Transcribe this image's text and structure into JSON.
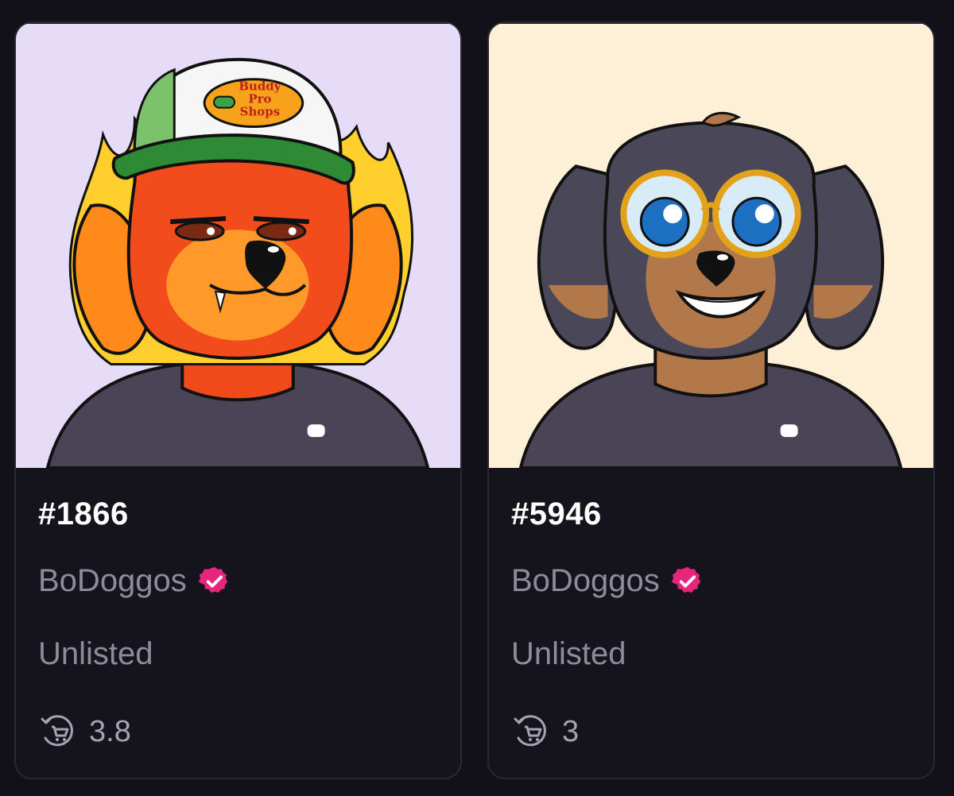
{
  "colors": {
    "page_background": "#121019",
    "card_background": "#15131c",
    "card_border": "#2b2835",
    "text_primary": "#ffffff",
    "text_secondary": "#8f8b9c",
    "verified_badge": "#e8257c"
  },
  "cards": [
    {
      "token_id": "#1866",
      "collection": "BoDoggos",
      "verified_icon": "verified-check-icon",
      "status": "Unlisted",
      "stat_icon": "cart-cycle-icon",
      "stat_value": "3.8",
      "art": {
        "description_icon": "flaming-dog-with-trucker-hat-image",
        "background": "#e6dcf7",
        "hat_text": [
          "Buddy",
          "Pro",
          "Shops"
        ]
      }
    },
    {
      "token_id": "#5946",
      "collection": "BoDoggos",
      "verified_icon": "verified-check-icon",
      "status": "Unlisted",
      "stat_icon": "cart-cycle-icon",
      "stat_value": "3",
      "art": {
        "description_icon": "dog-with-round-glasses-image",
        "background": "#fdf0d6"
      }
    }
  ]
}
